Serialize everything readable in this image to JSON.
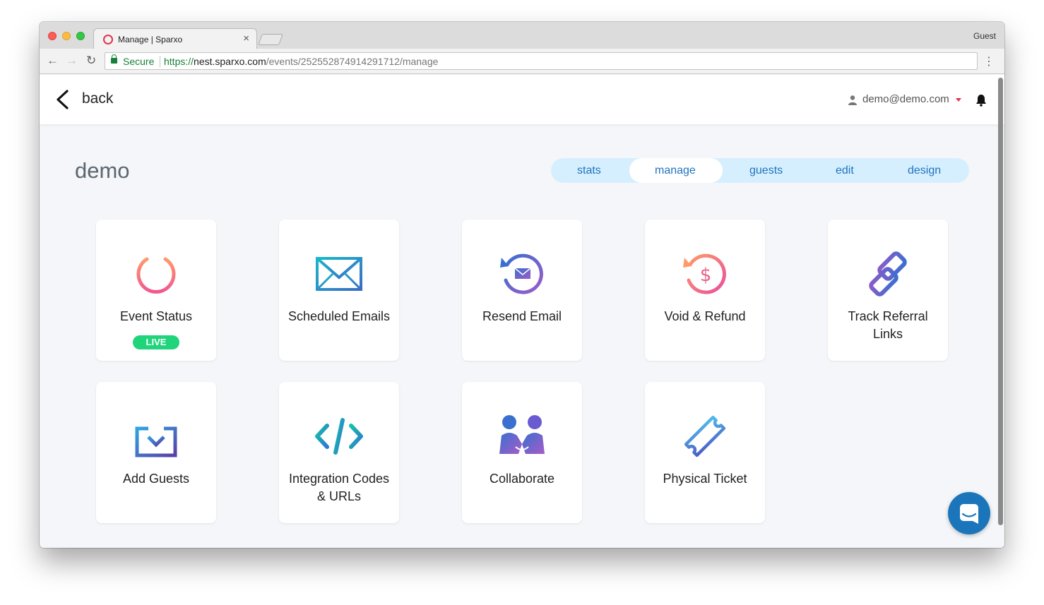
{
  "browser": {
    "tab_title": "Manage | Sparxo",
    "tab_close": "×",
    "profile": "Guest",
    "secure_label": "Secure",
    "url_scheme": "https://",
    "url_host": "nest.sparxo.com",
    "url_path": "/events/252552874914291712/manage"
  },
  "header": {
    "back_label": "back",
    "user_email": "demo@demo.com"
  },
  "event": {
    "title": "demo"
  },
  "tabs": [
    {
      "label": "stats"
    },
    {
      "label": "manage"
    },
    {
      "label": "guests"
    },
    {
      "label": "edit"
    },
    {
      "label": "design"
    }
  ],
  "active_tab": "manage",
  "cards": [
    {
      "label": "Event Status",
      "icon": "power-icon",
      "badge": "LIVE"
    },
    {
      "label": "Scheduled Emails",
      "icon": "envelope-icon"
    },
    {
      "label": "Resend Email",
      "icon": "resend-email-icon"
    },
    {
      "label": "Void & Refund",
      "icon": "refund-icon"
    },
    {
      "label": "Track Referral Links",
      "icon": "link-icon"
    },
    {
      "label": "Add Guests",
      "icon": "download-icon"
    },
    {
      "label": "Integration Codes & URLs",
      "icon": "code-icon"
    },
    {
      "label": "Collaborate",
      "icon": "collaborate-icon"
    },
    {
      "label": "Physical Ticket",
      "icon": "ticket-icon"
    }
  ],
  "colors": {
    "accent": "#1e73be",
    "tab_bg": "#d6efff",
    "live": "#1fd47a",
    "chat": "#1b75bb"
  }
}
